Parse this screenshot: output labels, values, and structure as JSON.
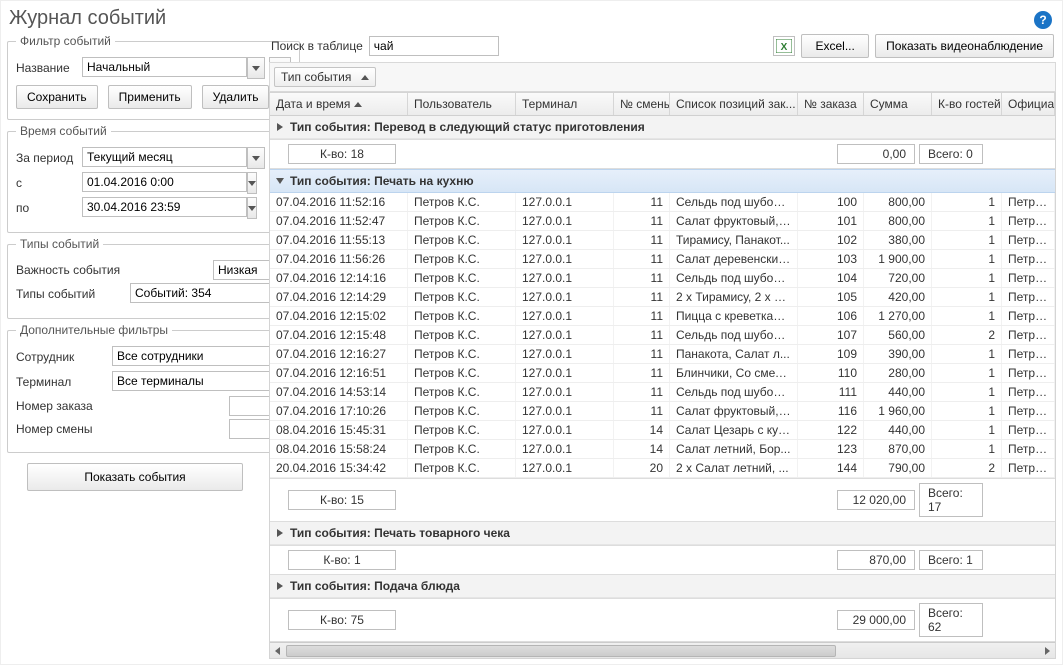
{
  "page_title": "Журнал событий",
  "help_glyph": "?",
  "filters": {
    "legend": "Фильтр событий",
    "name_label": "Название",
    "name_value": "Начальный",
    "ellipsis": "...",
    "save_btn": "Сохранить",
    "apply_btn": "Применить",
    "delete_btn": "Удалить"
  },
  "time": {
    "legend": "Время событий",
    "period_label": "За период",
    "period_value": "Текущий месяц",
    "from_label": "с",
    "from_value": "01.04.2016 0:00",
    "to_label": "по",
    "to_value": "30.04.2016 23:59"
  },
  "event_types": {
    "legend": "Типы событий",
    "importance_label": "Важность события",
    "importance_value": "Низкая",
    "types_label": "Типы событий",
    "types_value": "Событий: 354"
  },
  "extra": {
    "legend": "Дополнительные фильтры",
    "employee_label": "Сотрудник",
    "employee_value": "Все сотрудники",
    "plus": "+",
    "terminal_label": "Терминал",
    "terminal_value": "Все терминалы",
    "order_label": "Номер заказа",
    "order_value": "",
    "shift_label": "Номер смены",
    "shift_value": ""
  },
  "show_events_btn": "Показать события",
  "right_top": {
    "search_label": "Поиск в таблице",
    "search_value": "чай",
    "excel_btn": "Excel...",
    "video_btn": "Показать видеонаблюдение"
  },
  "group_chip": "Тип события",
  "columns": {
    "dt": "Дата и время",
    "user": "Пользователь",
    "term": "Терминал",
    "shift": "№ смены",
    "items": "Список позиций зак...",
    "ord": "№ заказа",
    "sum": "Сумма",
    "guest": "К-во гостей",
    "waiter": "Официант"
  },
  "groups": [
    {
      "title": "Тип события: Перевод в следующий статус приготовления",
      "expanded": false,
      "kvo": "К-во: 18",
      "sum": "0,00",
      "total": "Всего: 0",
      "rows": []
    },
    {
      "title": "Тип события: Печать на кухню",
      "expanded": true,
      "kvo": "К-во: 15",
      "sum": "12 020,00",
      "total": "Всего: 17",
      "rows": [
        {
          "dt": "07.04.2016 11:52:16",
          "user": "Петров К.С.",
          "term": "127.0.0.1",
          "shift": "11",
          "items": "Сельдь под шубой,...",
          "ord": "100",
          "sum": "800,00",
          "guest": "1",
          "waiter": "Петров К.С."
        },
        {
          "dt": "07.04.2016 11:52:47",
          "user": "Петров К.С.",
          "term": "127.0.0.1",
          "shift": "11",
          "items": "Салат фруктовый, ...",
          "ord": "101",
          "sum": "800,00",
          "guest": "1",
          "waiter": "Петров К.С."
        },
        {
          "dt": "07.04.2016 11:55:13",
          "user": "Петров К.С.",
          "term": "127.0.0.1",
          "shift": "11",
          "items": "Тирамису, Панакот...",
          "ord": "102",
          "sum": "380,00",
          "guest": "1",
          "waiter": "Петров К.С."
        },
        {
          "dt": "07.04.2016 11:56:26",
          "user": "Петров К.С.",
          "term": "127.0.0.1",
          "shift": "11",
          "items": "Салат деревенский...",
          "ord": "103",
          "sum": "1 900,00",
          "guest": "1",
          "waiter": "Петров К.С."
        },
        {
          "dt": "07.04.2016 12:14:16",
          "user": "Петров К.С.",
          "term": "127.0.0.1",
          "shift": "11",
          "items": "Сельдь под шубой,...",
          "ord": "104",
          "sum": "720,00",
          "guest": "1",
          "waiter": "Петров К.С."
        },
        {
          "dt": "07.04.2016 12:14:29",
          "user": "Петров К.С.",
          "term": "127.0.0.1",
          "shift": "11",
          "items": "2 x Тирамису, 2 x Ч...",
          "ord": "105",
          "sum": "420,00",
          "guest": "1",
          "waiter": "Петров К.С."
        },
        {
          "dt": "07.04.2016 12:15:02",
          "user": "Петров К.С.",
          "term": "127.0.0.1",
          "shift": "11",
          "items": "Пицца с креветкам...",
          "ord": "106",
          "sum": "1 270,00",
          "guest": "1",
          "waiter": "Петров К.С."
        },
        {
          "dt": "07.04.2016 12:15:48",
          "user": "Петров К.С.",
          "term": "127.0.0.1",
          "shift": "11",
          "items": "Сельдь под шубой,...",
          "ord": "107",
          "sum": "560,00",
          "guest": "2",
          "waiter": "Петров К.С."
        },
        {
          "dt": "07.04.2016 12:16:27",
          "user": "Петров К.С.",
          "term": "127.0.0.1",
          "shift": "11",
          "items": "Панакота, Салат л...",
          "ord": "109",
          "sum": "390,00",
          "guest": "1",
          "waiter": "Петров К.С."
        },
        {
          "dt": "07.04.2016 12:16:51",
          "user": "Петров К.С.",
          "term": "127.0.0.1",
          "shift": "11",
          "items": "Блинчики, Со смета...",
          "ord": "110",
          "sum": "280,00",
          "guest": "1",
          "waiter": "Петров К.С."
        },
        {
          "dt": "07.04.2016 14:53:14",
          "user": "Петров К.С.",
          "term": "127.0.0.1",
          "shift": "11",
          "items": "Сельдь под шубой,...",
          "ord": "111",
          "sum": "440,00",
          "guest": "1",
          "waiter": "Петров К.С."
        },
        {
          "dt": "07.04.2016 17:10:26",
          "user": "Петров К.С.",
          "term": "127.0.0.1",
          "shift": "11",
          "items": "Салат фруктовый, ...",
          "ord": "116",
          "sum": "1 960,00",
          "guest": "1",
          "waiter": "Петров К.С."
        },
        {
          "dt": "08.04.2016 15:45:31",
          "user": "Петров К.С.",
          "term": "127.0.0.1",
          "shift": "14",
          "items": "Салат Цезарь с кур...",
          "ord": "122",
          "sum": "440,00",
          "guest": "1",
          "waiter": "Петров К.С."
        },
        {
          "dt": "08.04.2016 15:58:24",
          "user": "Петров К.С.",
          "term": "127.0.0.1",
          "shift": "14",
          "items": "Салат летний, Бор...",
          "ord": "123",
          "sum": "870,00",
          "guest": "1",
          "waiter": "Петров К.С."
        },
        {
          "dt": "20.04.2016 15:34:42",
          "user": "Петров К.С.",
          "term": "127.0.0.1",
          "shift": "20",
          "items": "2 x Салат летний, ...",
          "ord": "144",
          "sum": "790,00",
          "guest": "2",
          "waiter": "Петров К.С."
        }
      ]
    },
    {
      "title": "Тип события: Печать товарного чека",
      "expanded": false,
      "kvo": "К-во: 1",
      "sum": "870,00",
      "total": "Всего: 1",
      "rows": []
    },
    {
      "title": "Тип события: Подача блюда",
      "expanded": false,
      "kvo": "К-во: 75",
      "sum": "29 000,00",
      "total": "Всего: 62",
      "rows": []
    }
  ]
}
